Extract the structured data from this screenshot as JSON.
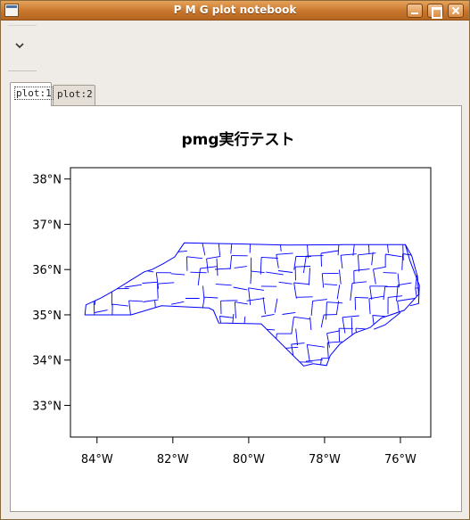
{
  "window": {
    "title": "P M G plot notebook"
  },
  "tabs": [
    {
      "label": "plot:1"
    },
    {
      "label": "plot:2"
    }
  ],
  "chart_data": {
    "type": "map",
    "title": "pmg実行テスト",
    "xlim": [
      -84.7,
      -75.2
    ],
    "ylim": [
      32.3,
      38.25
    ],
    "x_ticks": [
      {
        "value": -84,
        "label": "84°W"
      },
      {
        "value": -82,
        "label": "82°W"
      },
      {
        "value": -80,
        "label": "80°W"
      },
      {
        "value": -78,
        "label": "78°W"
      },
      {
        "value": -76,
        "label": "76°W"
      }
    ],
    "y_ticks": [
      {
        "value": 33,
        "label": "33°N"
      },
      {
        "value": 34,
        "label": "34°N"
      },
      {
        "value": 35,
        "label": "35°N"
      },
      {
        "value": 36,
        "label": "36°N"
      },
      {
        "value": 37,
        "label": "37°N"
      },
      {
        "value": 38,
        "label": "38°N"
      }
    ],
    "outline": [
      [
        -84.32,
        35.0
      ],
      [
        -84.29,
        35.22
      ],
      [
        -83.9,
        35.37
      ],
      [
        -83.5,
        35.56
      ],
      [
        -83.1,
        35.77
      ],
      [
        -82.75,
        35.95
      ],
      [
        -82.55,
        36.0
      ],
      [
        -82.25,
        36.13
      ],
      [
        -81.95,
        36.28
      ],
      [
        -81.7,
        36.59
      ],
      [
        -80.5,
        36.57
      ],
      [
        -79.0,
        36.54
      ],
      [
        -77.5,
        36.55
      ],
      [
        -76.2,
        36.55
      ],
      [
        -75.87,
        36.55
      ],
      [
        -75.7,
        36.3
      ],
      [
        -75.55,
        35.85
      ],
      [
        -75.52,
        35.45
      ],
      [
        -75.9,
        35.1
      ],
      [
        -76.5,
        34.93
      ],
      [
        -76.8,
        34.72
      ],
      [
        -77.2,
        34.6
      ],
      [
        -77.6,
        34.35
      ],
      [
        -77.85,
        34.1
      ],
      [
        -77.95,
        33.88
      ],
      [
        -78.3,
        33.92
      ],
      [
        -78.55,
        33.87
      ],
      [
        -79.67,
        34.8
      ],
      [
        -80.79,
        34.82
      ],
      [
        -80.93,
        35.1
      ],
      [
        -81.05,
        35.15
      ],
      [
        -82.3,
        35.2
      ],
      [
        -83.1,
        35.0
      ],
      [
        -84.32,
        35.0
      ]
    ],
    "barrier_islands": [
      [
        [
          -75.87,
          36.55
        ],
        [
          -75.75,
          36.2
        ],
        [
          -75.5,
          35.65
        ],
        [
          -75.52,
          35.25
        ],
        [
          -75.75,
          35.2
        ]
      ],
      [
        [
          -76.0,
          35.05
        ],
        [
          -76.4,
          34.78
        ],
        [
          -76.7,
          34.68
        ]
      ]
    ],
    "color": "#0000ff"
  }
}
